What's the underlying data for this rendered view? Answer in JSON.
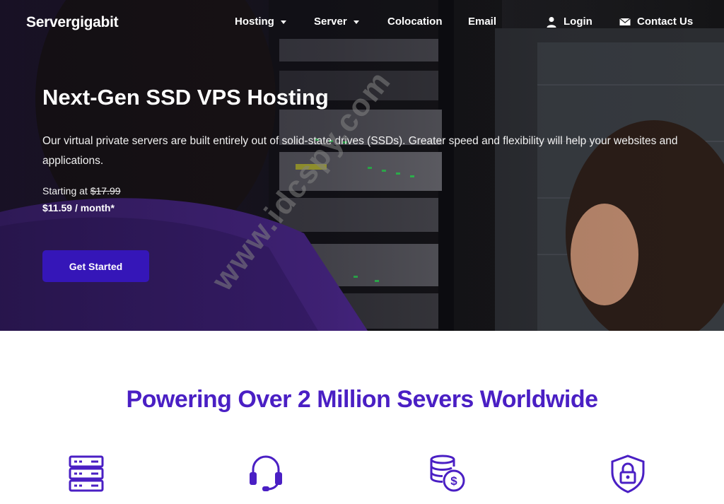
{
  "brand": {
    "logo_text": "Servergigabit",
    "accent_color": "#3516b8",
    "heading_color": "#4a1fc4"
  },
  "nav": {
    "items": [
      {
        "label": "Hosting",
        "has_dropdown": true
      },
      {
        "label": "Server",
        "has_dropdown": true
      },
      {
        "label": "Colocation",
        "has_dropdown": false
      },
      {
        "label": "Email",
        "has_dropdown": false
      }
    ],
    "login": {
      "label": "Login",
      "icon": "user-icon"
    },
    "contact": {
      "label": "Contact Us",
      "icon": "envelope-icon"
    }
  },
  "hero": {
    "title": "Next-Gen SSD VPS Hosting",
    "description": "Our virtual private servers are built entirely out of solid-state drives (SSDs). Greater speed and flexibility will help your websites and applications.",
    "starting_label": "Starting at",
    "old_price": "$17.99",
    "price": "$11.59 / month*",
    "cta_label": "Get Started"
  },
  "watermark": "www.idcspy.com",
  "section": {
    "heading": "Powering Over 2 Million Severs Worldwide",
    "icons": [
      "server-stack-icon",
      "headset-icon",
      "coins-dollar-icon",
      "shield-lock-icon"
    ]
  }
}
